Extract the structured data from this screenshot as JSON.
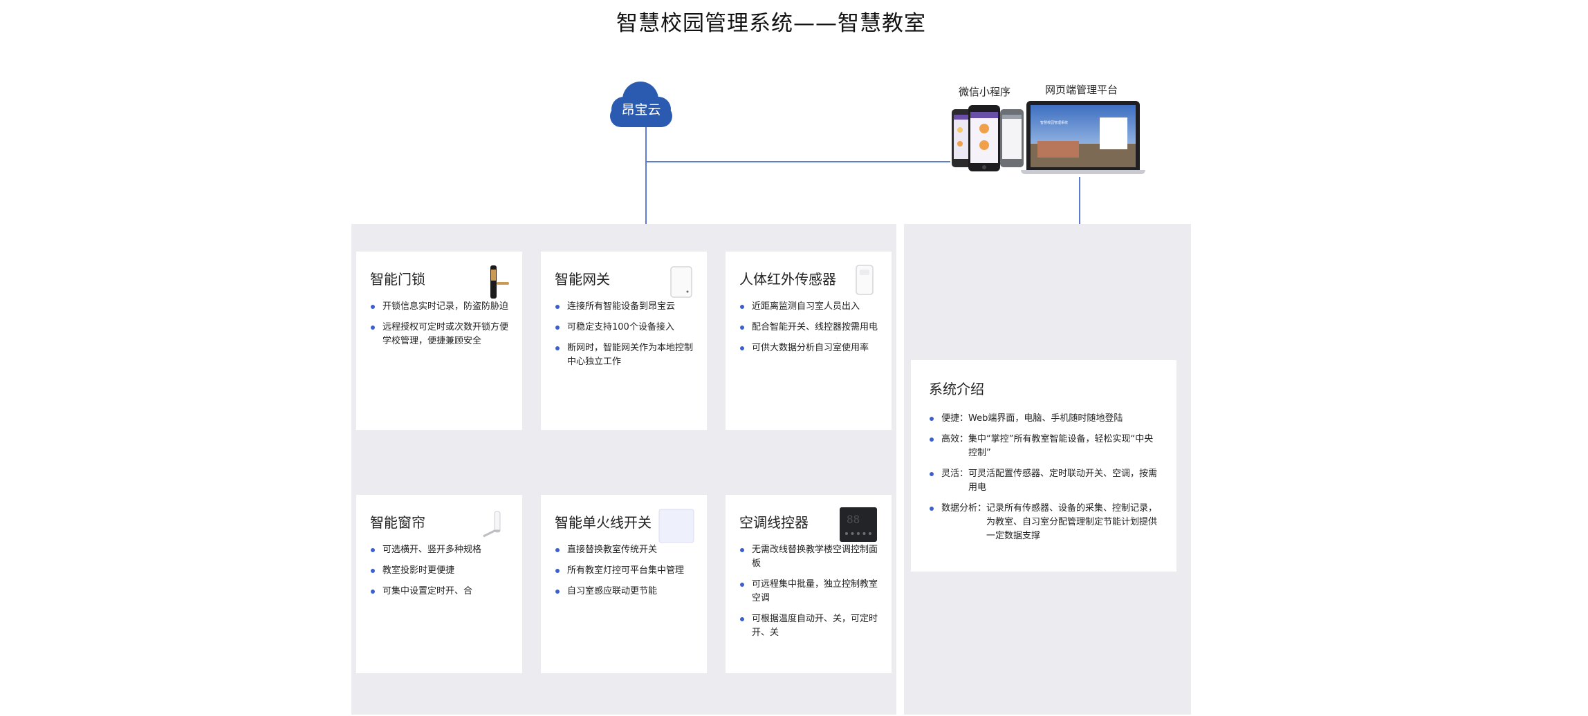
{
  "title": "智慧校园管理系统——智慧教室",
  "cloud": {
    "label": "昂宝云"
  },
  "devices": {
    "mini_program": "微信小程序",
    "web_platform": "网页端管理平台"
  },
  "web_screen": {
    "heading": "智慧校园管理系统"
  },
  "colors": {
    "accent": "#3c5fcf",
    "cloud": "#2a5bb0",
    "panel": "#ecebef",
    "connector": "#5b7bd5"
  },
  "cards_top": [
    {
      "title": "智能门锁",
      "icon": "door-lock-icon",
      "bullets": [
        "开锁信息实时记录，防盗防胁迫",
        "远程授权可定时或次数开锁方便学校管理，便捷兼顾安全"
      ]
    },
    {
      "title": "智能网关",
      "icon": "gateway-icon",
      "bullets": [
        "连接所有智能设备到昂宝云",
        "可稳定支持100个设备接入",
        "断网时，智能网关作为本地控制中心独立工作"
      ]
    },
    {
      "title": "人体红外传感器",
      "icon": "infrared-sensor-icon",
      "bullets": [
        "近距离监测自习室人员出入",
        "配合智能开关、线控器按需用电",
        "可供大数据分析自习室使用率"
      ]
    }
  ],
  "cards_bottom": [
    {
      "title": "智能窗帘",
      "icon": "curtain-motor-icon",
      "bullets": [
        "可选横开、竖开多种规格",
        "教室投影时更便捷",
        "可集中设置定时开、合"
      ]
    },
    {
      "title": "智能单火线开关",
      "icon": "wall-switch-icon",
      "bullets": [
        "直接替换教室传统开关",
        "所有教室灯控可平台集中管理",
        "自习室感应联动更节能"
      ]
    },
    {
      "title": "空调线控器",
      "icon": "ac-controller-icon",
      "display": "88",
      "bullets": [
        "无需改线替换教学楼空调控制面板",
        "可远程集中批量，独立控制教室空调",
        "可根据温度自动开、关，可定时开、关"
      ]
    }
  ],
  "intro": {
    "title": "系统介绍",
    "items": [
      {
        "key": "便捷：",
        "value": "Web端界面，电脑、手机随时随地登陆"
      },
      {
        "key": "高效：",
        "value": "集中“掌控”所有教室智能设备，轻松实现“中央控制”"
      },
      {
        "key": "灵活：",
        "value": "可灵活配置传感器、定时联动开关、空调，按需用电"
      },
      {
        "key": "数据分析：",
        "value": "记录所有传感器、设备的采集、控制记录，为教室、自习室分配管理制定节能计划提供一定数据支撑"
      }
    ]
  }
}
